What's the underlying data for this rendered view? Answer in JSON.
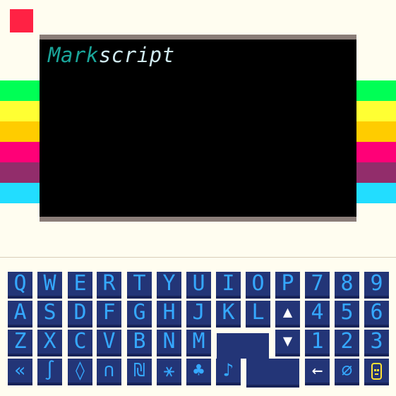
{
  "accent_colors": {
    "corner": "#ff2244",
    "stripes": [
      "#00ff55",
      "#ffff33",
      "#ffcc00",
      "#ff0077",
      "#922d6b",
      "#22ddff"
    ],
    "key_face": "#233577",
    "key_glyph": "#35a8ff"
  },
  "screen": {
    "title_part1": "Mark",
    "title_part2": "script"
  },
  "keys": {
    "row1": [
      "Q",
      "W",
      "E",
      "R",
      "T",
      "Y",
      "U",
      "I",
      "O",
      "P",
      "7",
      "8",
      "9"
    ],
    "row2": [
      "A",
      "S",
      "D",
      "F",
      "G",
      "H",
      "J",
      "K",
      "L",
      "▲",
      "4",
      "5",
      "6"
    ],
    "row3": [
      "Z",
      "X",
      "C",
      "V",
      "B",
      "N",
      "M",
      "▼",
      "1",
      "2",
      "3"
    ],
    "row4": [
      "«",
      "∫",
      "◊",
      "∩",
      "₪",
      "⚹",
      "♣",
      "♪",
      "←",
      "∅"
    ]
  },
  "icons": {
    "backspace": "double-chevron-left-icon",
    "enter": "return-key",
    "cursor_up": "triangle-up-icon",
    "cursor_down": "triangle-down-icon",
    "robot": "robot-face-icon"
  }
}
